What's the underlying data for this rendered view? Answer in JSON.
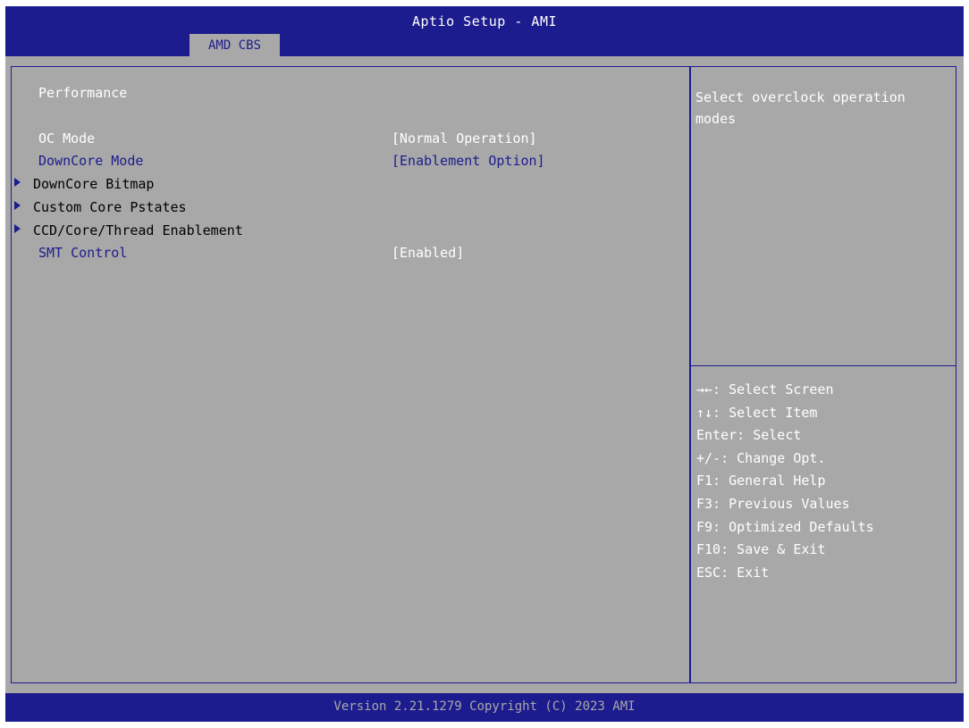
{
  "header": {
    "title": "Aptio Setup - AMI",
    "tab": "AMD CBS"
  },
  "main": {
    "section_title": "Performance",
    "items": [
      {
        "label": "OC Mode",
        "value": "[Normal Operation]"
      },
      {
        "label": "DownCore Mode",
        "value": "[Enablement Option]"
      },
      {
        "label": "DownCore Bitmap"
      },
      {
        "label": "Custom Core Pstates"
      },
      {
        "label": "CCD/Core/Thread Enablement"
      },
      {
        "label": "SMT Control",
        "value": "[Enabled]"
      }
    ]
  },
  "help": {
    "text": "Select overclock operation modes"
  },
  "keys": [
    "→←: Select Screen",
    "↑↓: Select Item",
    "Enter: Select",
    "+/-: Change Opt.",
    "F1: General Help",
    "F3: Previous Values",
    "F9: Optimized Defaults",
    "F10: Save & Exit",
    "ESC: Exit"
  ],
  "footer": {
    "version": "Version 2.21.1279 Copyright (C) 2023 AMI"
  },
  "colors": {
    "bios_blue": "#1c1c8e",
    "panel_gray": "#a8a8a8",
    "text_white": "#ffffff"
  }
}
